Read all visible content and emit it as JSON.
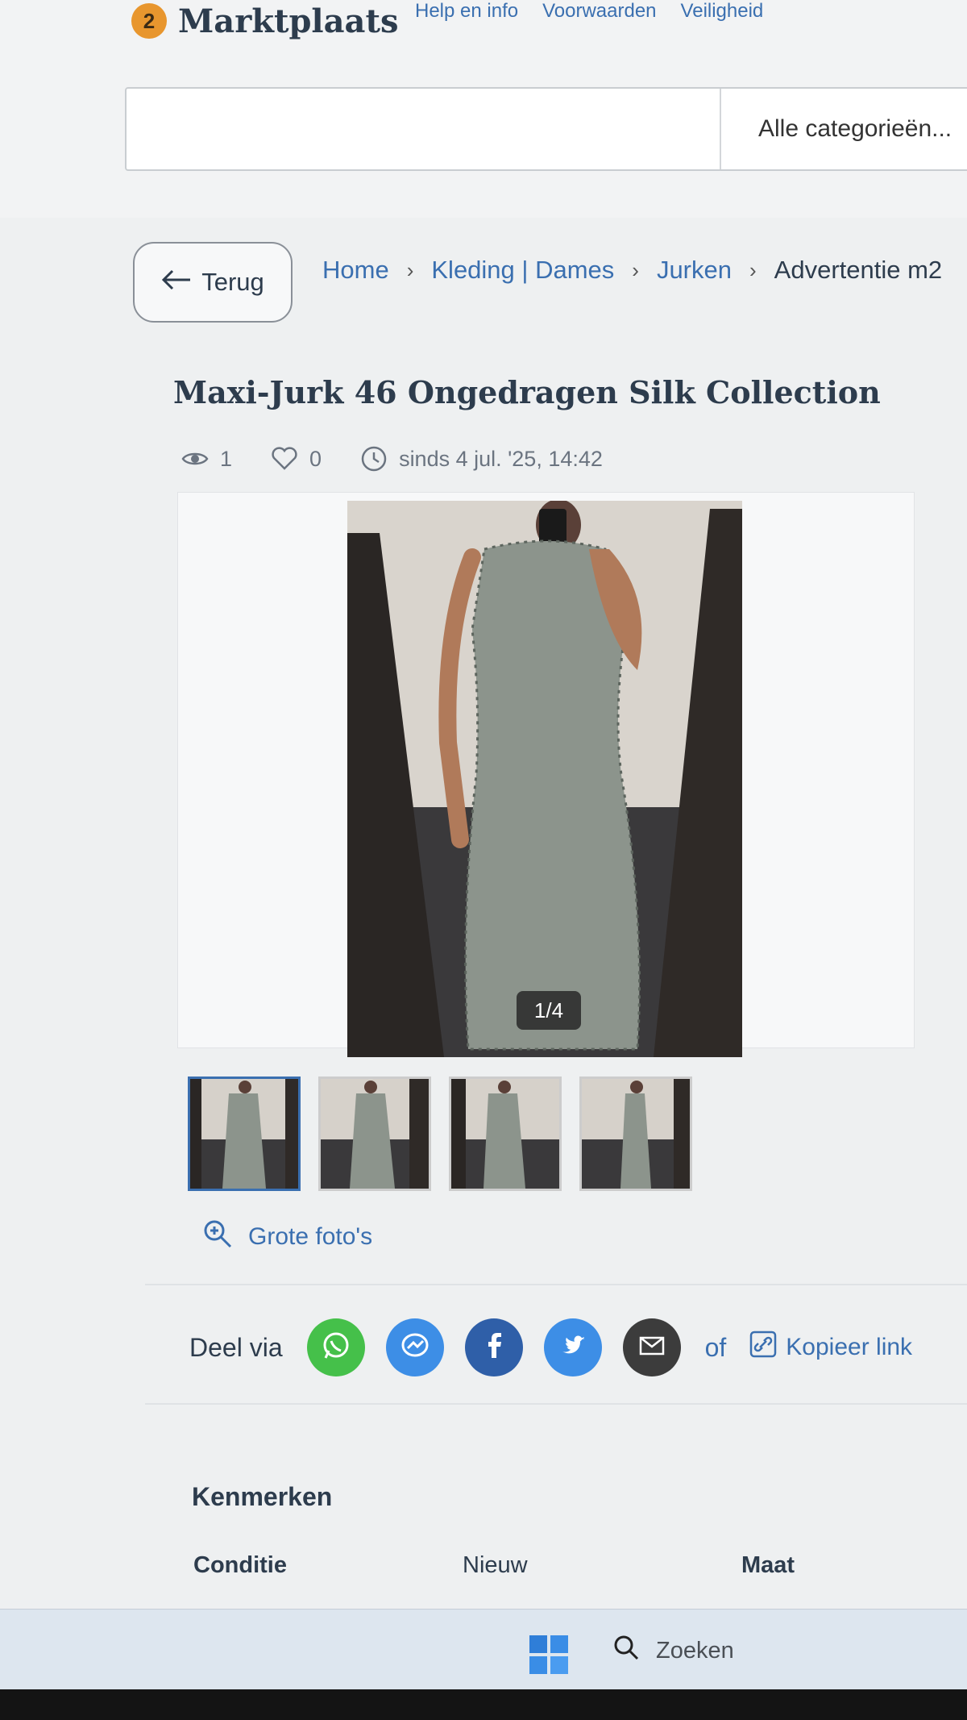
{
  "header": {
    "logo_number": "2",
    "logo_text": "Marktplaats",
    "top_links": [
      "Help en info",
      "Voorwaarden",
      "Veiligheid"
    ],
    "search": {
      "value": "",
      "placeholder": ""
    },
    "category_select": "Alle categorieën..."
  },
  "breadcrumb": {
    "back_label": "Terug",
    "items": [
      "Home",
      "Kleding | Dames",
      "Jurken",
      "Advertentie m2"
    ]
  },
  "listing": {
    "title": "Maxi-Jurk 46 Ongedragen Silk Collection",
    "views": "1",
    "favorites": "0",
    "date": "sinds 4 jul. '25, 14:42",
    "photo_counter": "1/4",
    "zoom_label": "Grote foto's"
  },
  "share": {
    "label": "Deel via",
    "channels": [
      "whatsapp-icon",
      "messenger-icon",
      "facebook-icon",
      "twitter-icon",
      "mail-icon"
    ],
    "or_label": "of",
    "copy_label": "Kopieer link",
    "colors": {
      "whatsapp": "#45c04a",
      "messenger": "#3d8ee6",
      "facebook": "#2f5fa8",
      "twitter": "#3d8ee6",
      "mail": "#3c3c3c"
    }
  },
  "attributes": {
    "section_title": "Kenmerken",
    "rows": [
      {
        "name": "Conditie",
        "value": "Nieuw"
      },
      {
        "name": "Maat",
        "value": ""
      }
    ]
  },
  "taskbar": {
    "search_label": "Zoeken"
  },
  "colors": {
    "link": "#3a6fb0",
    "logo_accent": "#e8962e",
    "text": "#2d3c4d"
  }
}
